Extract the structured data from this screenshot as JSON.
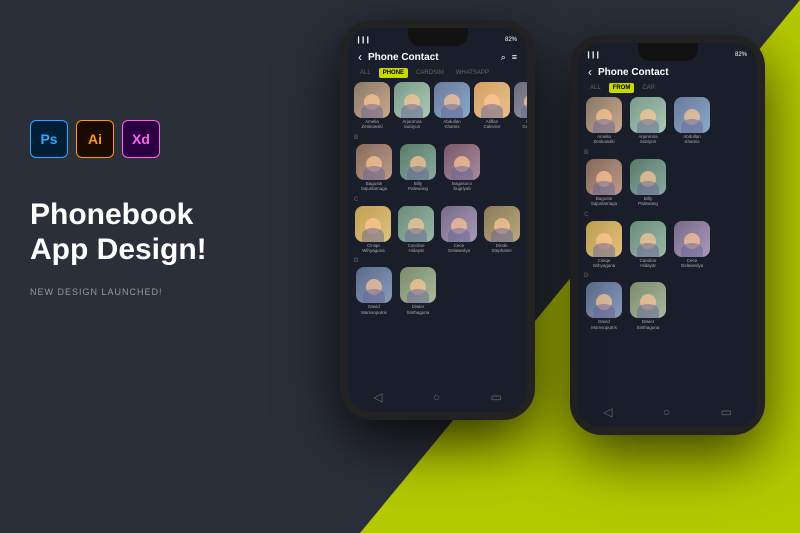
{
  "background": {
    "left_color": "#2b2f3a",
    "right_color": "#b5c900"
  },
  "left_panel": {
    "icons": [
      {
        "id": "ps",
        "label": "Ps",
        "css_class": "icon-ps"
      },
      {
        "id": "ai",
        "label": "Ai",
        "css_class": "icon-ai"
      },
      {
        "id": "xd",
        "label": "Xd",
        "css_class": "icon-xd"
      }
    ],
    "title_line1": "Phonebook",
    "title_line2": "App Design!",
    "subtitle": "New Design Launched!"
  },
  "phone1": {
    "status_bar": {
      "signal": "▎▎▎",
      "wifi": "wifi",
      "battery": "82%"
    },
    "header": {
      "back": "‹",
      "title": "Phone Contact",
      "search_icon": "🔍",
      "menu_icon": "≡"
    },
    "tabs": [
      {
        "label": "ALL",
        "active": false
      },
      {
        "label": "PHONE",
        "active": true
      },
      {
        "label": "CARDSIM",
        "active": false
      },
      {
        "label": "WHATSAPP",
        "active": false
      }
    ],
    "contacts": [
      [
        {
          "name": "Amelia\nZenkowski",
          "av": "av1"
        },
        {
          "name": "Arjunmira\nSubiyun",
          "av": "av2"
        },
        {
          "name": "Abdullan\nKhamis",
          "av": "av3"
        },
        {
          "name": "Aliffan\nCakrolor",
          "av": "av4"
        },
        {
          "name": "Andric\nGuwirdha",
          "av": "av5"
        }
      ],
      [
        {
          "name": "Baguste\nSajunlamaga",
          "av": "av6"
        },
        {
          "name": "Billy\nPalewang",
          "av": "av7"
        },
        {
          "name": "Bagasoco\nSugriyab",
          "av": "av8"
        }
      ],
      [
        {
          "name": "Ciniqe\nWihyaguna",
          "av": "av9"
        },
        {
          "name": "Caroline\nHidayat",
          "av": "av10"
        },
        {
          "name": "Cece\nGelawedya",
          "av": "av11"
        },
        {
          "name": "Dinde\nStephanie",
          "av": "av12"
        }
      ],
      [
        {
          "name": "David\nMamsoputris",
          "av": "av13"
        },
        {
          "name": "Diwier\nSinthaguna",
          "av": "av14"
        }
      ]
    ],
    "bottom_nav": [
      "◁",
      "○",
      "▭"
    ]
  },
  "phone2": {
    "header_title": "Phone Contact",
    "tabs": [
      {
        "label": "ALL",
        "active": false
      },
      {
        "label": "FROM",
        "active": true
      },
      {
        "label": "CAR",
        "active": false
      }
    ]
  }
}
